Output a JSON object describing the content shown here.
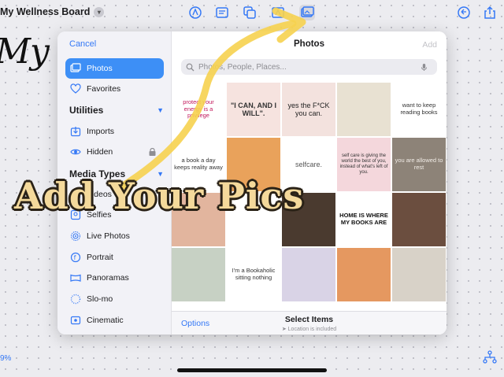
{
  "board": {
    "title": "My Wellness Board",
    "bg_script": "My W",
    "zoom": "9%"
  },
  "toolbar": {
    "tools": [
      "pen-tool-icon",
      "text-box-icon",
      "shapes-icon",
      "text-icon",
      "photo-icon"
    ],
    "right_tools": [
      "undo-icon",
      "share-icon"
    ]
  },
  "picker": {
    "cancel": "Cancel",
    "title": "Photos",
    "add": "Add",
    "search_placeholder": "Photos, People, Places...",
    "sidebar": {
      "photos": "Photos",
      "favorites": "Favorites",
      "utilities_header": "Utilities",
      "imports": "Imports",
      "hidden": "Hidden",
      "media_types_header": "Media Types",
      "videos": "Videos",
      "selfies": "Selfies",
      "live_photos": "Live Photos",
      "portrait": "Portrait",
      "panoramas": "Panoramas",
      "slomo": "Slo-mo",
      "cinematic": "Cinematic"
    },
    "options": "Options",
    "select_items": "Select Items",
    "location_note": "Location is included",
    "tiles": [
      {
        "bg": "#ffffff",
        "text": "protect your energy is a privilege",
        "color": "#c2185b"
      },
      {
        "bg": "#f6e3df",
        "text": "\"I CAN, AND I WILL\".",
        "color": "#333333"
      },
      {
        "bg": "#f3e2de",
        "text": "yes the F*CK you can.",
        "color": "#222222"
      },
      {
        "bg": "#e8e1d2",
        "text": "",
        "color": "#333333"
      },
      {
        "bg": "#ffffff",
        "text": "want to keep reading books",
        "color": "#333333"
      },
      {
        "bg": "#ffffff",
        "text": "a book a day keeps reality away",
        "color": "#333333"
      },
      {
        "bg": "#e9a25b",
        "text": "",
        "color": "#333333"
      },
      {
        "bg": "#ffffff",
        "text": "selfcare.",
        "color": "#555555"
      },
      {
        "bg": "#f4d7dc",
        "text": "self care is giving the world the best of you, instead of what's left of you.",
        "color": "#333333"
      },
      {
        "bg": "#8d8378",
        "text": "you are allowed to rest",
        "color": "#f1ece6"
      },
      {
        "bg": "#e2b59e",
        "text": "",
        "color": "#333333"
      },
      {
        "bg": "#ffffff",
        "text": "",
        "color": "#333333"
      },
      {
        "bg": "#4a3a2f",
        "text": "",
        "color": "#333333"
      },
      {
        "bg": "#ffffff",
        "text": "HOME IS WHERE MY BOOKS ARE",
        "color": "#111111"
      },
      {
        "bg": "#6b4e3f",
        "text": "",
        "color": "#333333"
      },
      {
        "bg": "#c7d1c4",
        "text": "",
        "color": "#333333"
      },
      {
        "bg": "#ffffff",
        "text": "I'm a Bookaholic sitting nothing",
        "color": "#333333"
      },
      {
        "bg": "#d9d3e6",
        "text": "",
        "color": "#333333"
      },
      {
        "bg": "#e59860",
        "text": "",
        "color": "#333333"
      },
      {
        "bg": "#d8d2c8",
        "text": "",
        "color": "#333333"
      }
    ]
  },
  "overlay": {
    "caption": "Add Your Pics",
    "arrow_color": "#f6d24f"
  }
}
